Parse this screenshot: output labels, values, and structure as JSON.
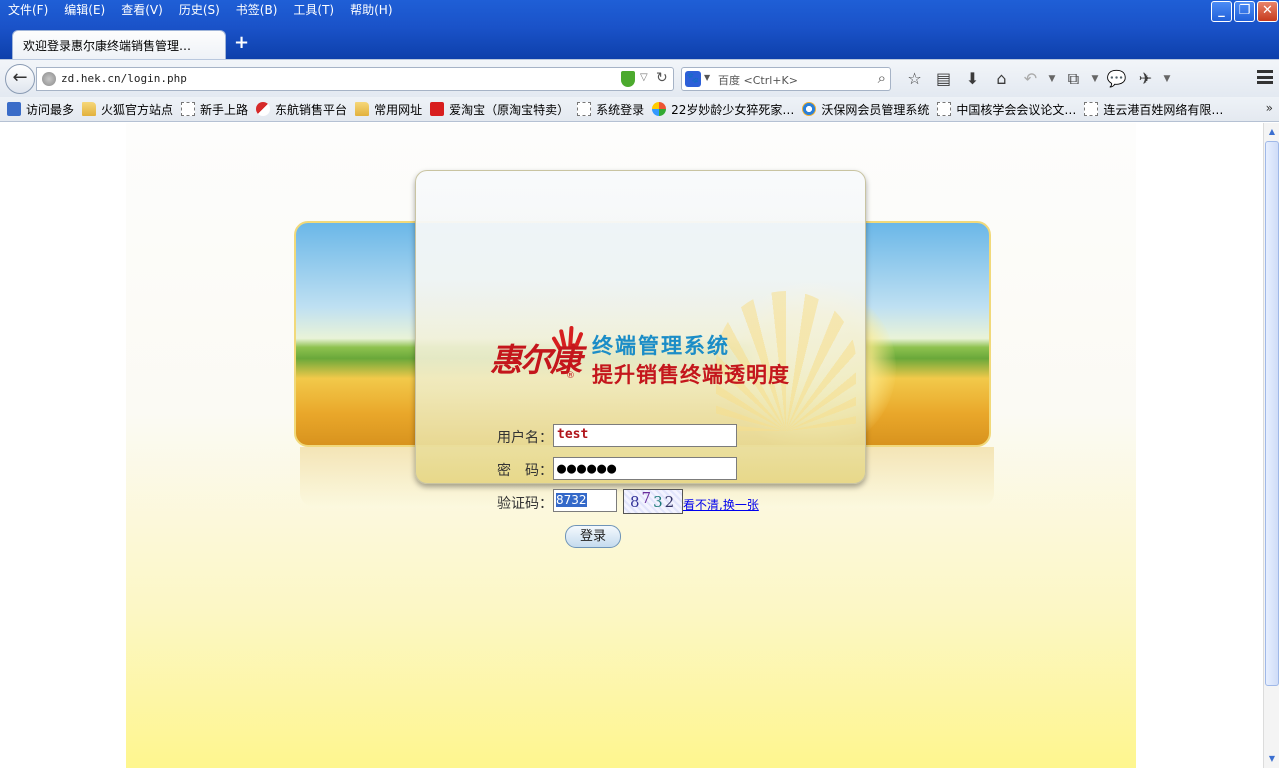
{
  "browser": {
    "menu": [
      "文件(F)",
      "编辑(E)",
      "查看(V)",
      "历史(S)",
      "书签(B)",
      "工具(T)",
      "帮助(H)"
    ],
    "tab_title": "欢迎登录惠尔康终端销售管理…",
    "new_tab": "+",
    "url": "zd.hek.cn/login.php",
    "search_engine": "百度",
    "search_placeholder": "百度 <Ctrl+K>",
    "window_controls": {
      "minimize": "_",
      "restore": "❐",
      "close": "✕"
    }
  },
  "bookmarks": [
    {
      "label": "访问最多",
      "icon": "search-icon"
    },
    {
      "label": "火狐官方站点",
      "icon": "folder-icon"
    },
    {
      "label": "新手上路",
      "icon": "page-icon"
    },
    {
      "label": "东航销售平台",
      "icon": "airline-icon"
    },
    {
      "label": "常用网址",
      "icon": "folder-icon"
    },
    {
      "label": "爱淘宝（原淘宝特卖）",
      "icon": "taobao-icon"
    },
    {
      "label": "系统登录",
      "icon": "page-icon"
    },
    {
      "label": "22岁妙龄少女猝死家…",
      "icon": "pinwheel-icon"
    },
    {
      "label": "沃保网会员管理系统",
      "icon": "ie-icon"
    },
    {
      "label": "中国核学会会议论文…",
      "icon": "page-icon"
    },
    {
      "label": "连云港百姓网络有限…",
      "icon": "page-icon"
    }
  ],
  "bookmarks_more": "»",
  "brand": {
    "logo_text": "惠尔康",
    "logo_reg": "®",
    "system_title": "终端管理系统",
    "slogan": "提升销售终端透明度",
    "red": "#c4161c",
    "blue": "#1b8dc7"
  },
  "login": {
    "username_label": "用户名：",
    "username_value": "test",
    "password_label": "密　码：",
    "password_value": "●●●●●●",
    "captcha_label": "验证码：",
    "captcha_value": "8732",
    "captcha_chars": [
      "8",
      "7",
      "3",
      "2"
    ],
    "captcha_link": "看不清,换一张",
    "submit": "登录"
  }
}
